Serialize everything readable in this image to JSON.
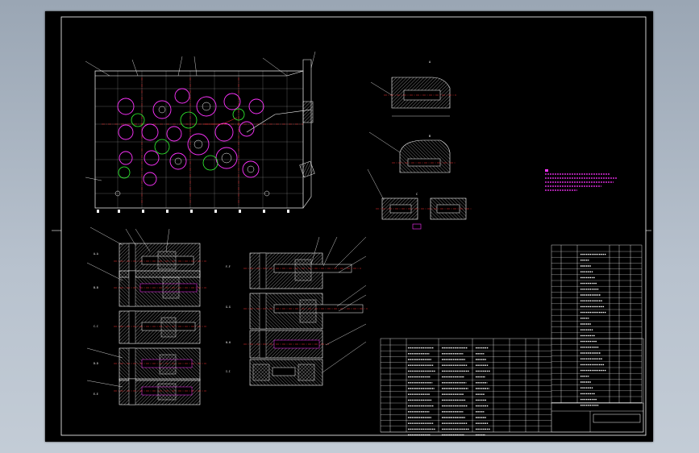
{
  "drawing": {
    "background": "#000000",
    "line_colors": {
      "outline": "#ffffff",
      "center": "#ff3333",
      "circle_a": "#ff33ff",
      "circle_b": "#33ff33",
      "hatch": "#d0d0d0",
      "note": "#ff33ff",
      "dim": "#00ffff"
    }
  },
  "left_section_labels": [
    "A-A",
    "B-B",
    "C-C",
    "D-D",
    "E-E"
  ],
  "mid_section_labels": [
    "F-F",
    "G-G",
    "H-H",
    "I-I"
  ],
  "detail_labels": [
    "A",
    "B",
    "C"
  ],
  "title_block": {
    "code": "",
    "sheet": ""
  }
}
